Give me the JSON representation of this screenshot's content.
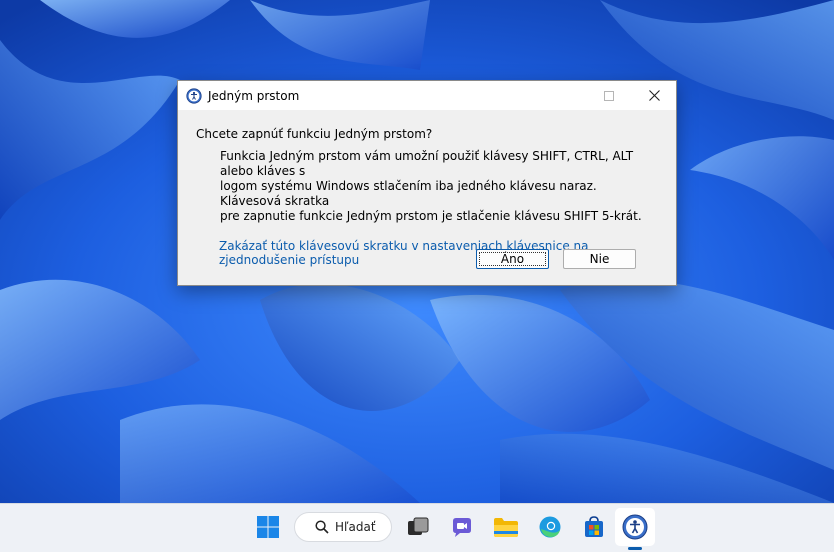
{
  "dialog": {
    "title": "Jedným prstom",
    "question": "Chcete zapnúť funkciu Jedným prstom?",
    "description_lines": [
      "Funkcia Jedným prstom vám umožní použiť klávesy SHIFT, CTRL, ALT alebo kláves s",
      "logom systému Windows stlačením iba jedného klávesu naraz. Klávesová skratka",
      "pre zapnutie funkcie Jedným prstom je stlačenie klávesu SHIFT 5-krát."
    ],
    "link": "Zakázať túto klávesovú skratku v nastaveniach klávesnice na zjednodušenie prístupu",
    "yes_label": "Áno",
    "no_label": "Nie"
  },
  "taskbar": {
    "search_label": "Hľadať",
    "icons": [
      "windows-start-icon",
      "search-icon",
      "task-view-icon",
      "chat-icon",
      "file-explorer-icon",
      "edge-icon",
      "store-icon",
      "accessibility-icon"
    ]
  },
  "colors": {
    "link": "#0b5cad",
    "wallpaper": "#1c5bd8",
    "taskbar": "#eef1f6"
  }
}
